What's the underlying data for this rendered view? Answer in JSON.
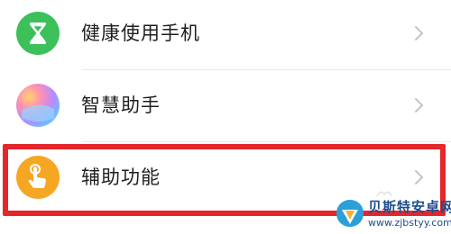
{
  "settings": {
    "items": [
      {
        "label": "健康使用手机",
        "icon": "hourglass-icon",
        "icon_color": "#3cc05a"
      },
      {
        "label": "智慧助手",
        "icon": "smart-assistant-icon"
      },
      {
        "label": "辅助功能",
        "icon": "hand-tap-icon",
        "icon_color": "#f5a623"
      }
    ]
  },
  "highlight_color": "#e5262a",
  "watermark": {
    "title": "贝斯特安卓网",
    "url": "www.zjbstyy.com"
  }
}
